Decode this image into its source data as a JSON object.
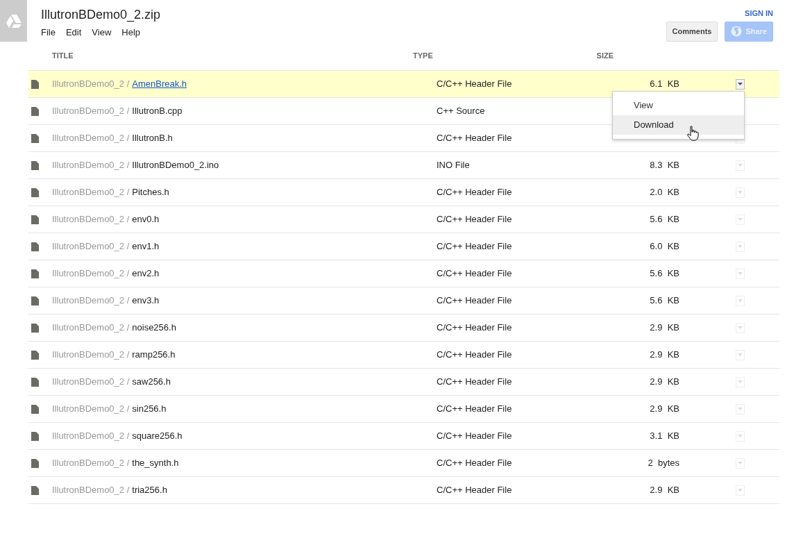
{
  "header": {
    "title": "IllutronBDemo0_2.zip",
    "menu": [
      "File",
      "Edit",
      "View",
      "Help"
    ],
    "sign_in": "SIGN IN",
    "buttons": [
      {
        "label": "Comments",
        "disabled": false
      },
      {
        "label": "Share",
        "disabled": true
      }
    ]
  },
  "table": {
    "columns": [
      "TITLE",
      "TYPE",
      "SIZE"
    ],
    "rows": [
      {
        "folder": "IllutronBDemo0_2 /",
        "name": "AmenBreak.h",
        "type": "C/C++ Header File",
        "size": "6.1  KB",
        "selected": true
      },
      {
        "folder": "IllutronBDemo0_2 /",
        "name": "IllutronB.cpp",
        "type": "C++ Source",
        "selected": false
      },
      {
        "folder": "IllutronBDemo0_2 /",
        "name": "IllutronB.h",
        "type": "C/C++ Header File",
        "selected": false
      },
      {
        "folder": "IllutronBDemo0_2 /",
        "name": "IllutronBDemo0_2.ino",
        "type": "INO File",
        "size": "8.3  KB",
        "selected": false
      },
      {
        "folder": "IllutronBDemo0_2 /",
        "name": "Pitches.h",
        "type": "C/C++ Header File",
        "size": "2.0  KB",
        "selected": false
      },
      {
        "folder": "IllutronBDemo0_2 /",
        "name": "env0.h",
        "type": "C/C++ Header File",
        "size": "5.6  KB",
        "selected": false
      },
      {
        "folder": "IllutronBDemo0_2 /",
        "name": "env1.h",
        "type": "C/C++ Header File",
        "size": "6.0  KB",
        "selected": false
      },
      {
        "folder": "IllutronBDemo0_2 /",
        "name": "env2.h",
        "type": "C/C++ Header File",
        "size": "5.6  KB",
        "selected": false
      },
      {
        "folder": "IllutronBDemo0_2 /",
        "name": "env3.h",
        "type": "C/C++ Header File",
        "size": "5.6  KB",
        "selected": false
      },
      {
        "folder": "IllutronBDemo0_2 /",
        "name": "noise256.h",
        "type": "C/C++ Header File",
        "size": "2.9  KB",
        "selected": false
      },
      {
        "folder": "IllutronBDemo0_2 /",
        "name": "ramp256.h",
        "type": "C/C++ Header File",
        "size": "2.9  KB",
        "selected": false
      },
      {
        "folder": "IllutronBDemo0_2 /",
        "name": "saw256.h",
        "type": "C/C++ Header File",
        "size": "2.9  KB",
        "selected": false
      },
      {
        "folder": "IllutronBDemo0_2 /",
        "name": "sin256.h",
        "type": "C/C++ Header File",
        "size": "2.9  KB",
        "selected": false
      },
      {
        "folder": "IllutronBDemo0_2 /",
        "name": "square256.h",
        "type": "C/C++ Header File",
        "size": "3.1  KB",
        "selected": false
      },
      {
        "folder": "IllutronBDemo0_2 /",
        "name": "the_synth.h",
        "type": "C/C++ Header File",
        "size": "2  bytes",
        "selected": false
      },
      {
        "folder": "IllutronBDemo0_2 /",
        "name": "tria256.h",
        "type": "C/C++ Header File",
        "size": "2.9  KB",
        "selected": false
      }
    ]
  },
  "context_menu": {
    "items": [
      {
        "label": "View",
        "selected": false
      },
      {
        "label": "Download",
        "selected": true
      }
    ]
  }
}
